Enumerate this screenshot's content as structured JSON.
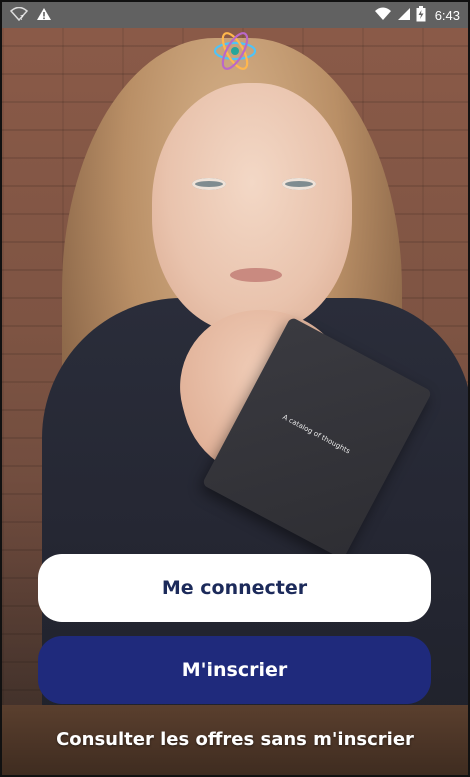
{
  "status_bar": {
    "time": "6:43",
    "icons": [
      "wifi-question-icon",
      "warning-icon",
      "wifi-icon",
      "signal-icon",
      "battery-charging-icon"
    ]
  },
  "hero": {
    "notebook_text": "A catalog of thoughts"
  },
  "actions": {
    "login_label": "Me connecter",
    "signup_label": "M'inscrier",
    "browse_label": "Consulter les offres sans m'inscrier"
  },
  "colors": {
    "primary": "#1f2a7c",
    "login_bg": "#ffffff",
    "login_text": "#1c2a5a",
    "status_bar": "#616161"
  }
}
